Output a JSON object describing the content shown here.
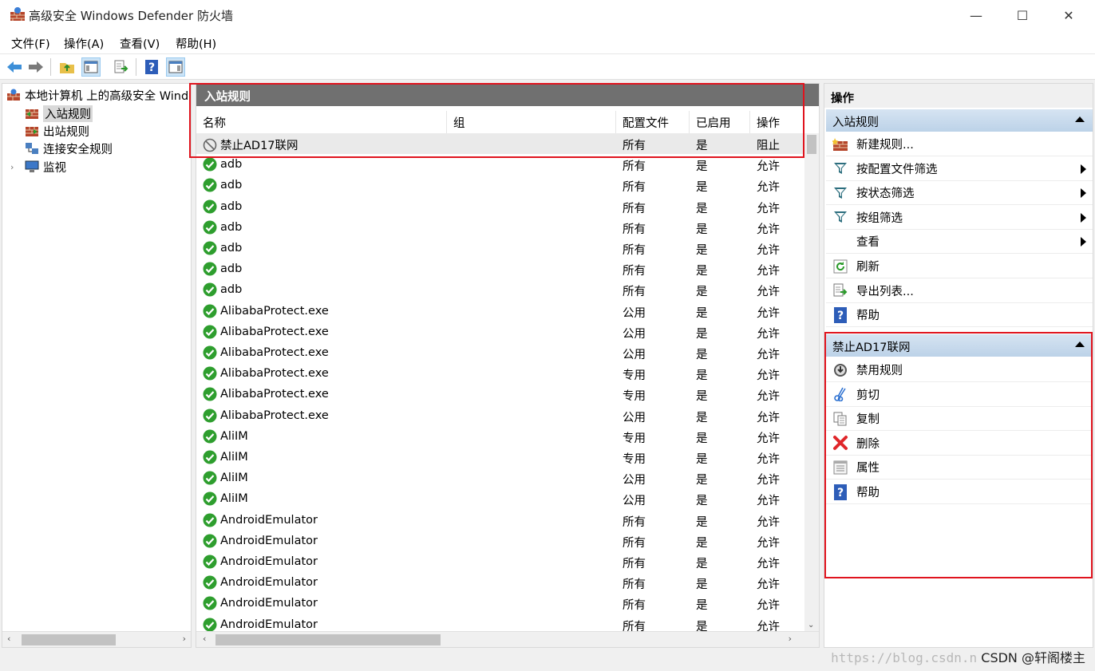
{
  "window": {
    "title": "高级安全 Windows Defender 防火墙",
    "minimize": "—",
    "maximize": "☐",
    "close": "✕"
  },
  "menu": [
    "文件(F)",
    "操作(A)",
    "查看(V)",
    "帮助(H)"
  ],
  "tree": {
    "root": "本地计算机 上的高级安全 Windows Defender 防火墙",
    "items": [
      "入站规则",
      "出站规则",
      "连接安全规则",
      "监视"
    ]
  },
  "list": {
    "header": "入站规则",
    "columns": [
      "名称",
      "组",
      "配置文件",
      "已启用",
      "操作"
    ],
    "rows": [
      {
        "name": "禁止AD17联网",
        "group": "",
        "profile": "所有",
        "enabled": "是",
        "action": "阻止",
        "status": "blocked"
      },
      {
        "name": "adb",
        "group": "",
        "profile": "所有",
        "enabled": "是",
        "action": "允许",
        "status": "allowed"
      },
      {
        "name": "adb",
        "group": "",
        "profile": "所有",
        "enabled": "是",
        "action": "允许",
        "status": "allowed"
      },
      {
        "name": "adb",
        "group": "",
        "profile": "所有",
        "enabled": "是",
        "action": "允许",
        "status": "allowed"
      },
      {
        "name": "adb",
        "group": "",
        "profile": "所有",
        "enabled": "是",
        "action": "允许",
        "status": "allowed"
      },
      {
        "name": "adb",
        "group": "",
        "profile": "所有",
        "enabled": "是",
        "action": "允许",
        "status": "allowed"
      },
      {
        "name": "adb",
        "group": "",
        "profile": "所有",
        "enabled": "是",
        "action": "允许",
        "status": "allowed"
      },
      {
        "name": "adb",
        "group": "",
        "profile": "所有",
        "enabled": "是",
        "action": "允许",
        "status": "allowed"
      },
      {
        "name": "AlibabaProtect.exe",
        "group": "",
        "profile": "公用",
        "enabled": "是",
        "action": "允许",
        "status": "allowed"
      },
      {
        "name": "AlibabaProtect.exe",
        "group": "",
        "profile": "公用",
        "enabled": "是",
        "action": "允许",
        "status": "allowed"
      },
      {
        "name": "AlibabaProtect.exe",
        "group": "",
        "profile": "公用",
        "enabled": "是",
        "action": "允许",
        "status": "allowed"
      },
      {
        "name": "AlibabaProtect.exe",
        "group": "",
        "profile": "专用",
        "enabled": "是",
        "action": "允许",
        "status": "allowed"
      },
      {
        "name": "AlibabaProtect.exe",
        "group": "",
        "profile": "专用",
        "enabled": "是",
        "action": "允许",
        "status": "allowed"
      },
      {
        "name": "AlibabaProtect.exe",
        "group": "",
        "profile": "公用",
        "enabled": "是",
        "action": "允许",
        "status": "allowed"
      },
      {
        "name": "AliIM",
        "group": "",
        "profile": "专用",
        "enabled": "是",
        "action": "允许",
        "status": "allowed"
      },
      {
        "name": "AliIM",
        "group": "",
        "profile": "专用",
        "enabled": "是",
        "action": "允许",
        "status": "allowed"
      },
      {
        "name": "AliIM",
        "group": "",
        "profile": "公用",
        "enabled": "是",
        "action": "允许",
        "status": "allowed"
      },
      {
        "name": "AliIM",
        "group": "",
        "profile": "公用",
        "enabled": "是",
        "action": "允许",
        "status": "allowed"
      },
      {
        "name": "AndroidEmulator",
        "group": "",
        "profile": "所有",
        "enabled": "是",
        "action": "允许",
        "status": "allowed"
      },
      {
        "name": "AndroidEmulator",
        "group": "",
        "profile": "所有",
        "enabled": "是",
        "action": "允许",
        "status": "allowed"
      },
      {
        "name": "AndroidEmulator",
        "group": "",
        "profile": "所有",
        "enabled": "是",
        "action": "允许",
        "status": "allowed"
      },
      {
        "name": "AndroidEmulator",
        "group": "",
        "profile": "所有",
        "enabled": "是",
        "action": "允许",
        "status": "allowed"
      },
      {
        "name": "AndroidEmulator",
        "group": "",
        "profile": "所有",
        "enabled": "是",
        "action": "允许",
        "status": "allowed"
      },
      {
        "name": "AndroidEmulator",
        "group": "",
        "profile": "所有",
        "enabled": "是",
        "action": "允许",
        "status": "allowed"
      }
    ]
  },
  "actions": {
    "title": "操作",
    "section1": {
      "label": "入站规则",
      "items": [
        {
          "label": "新建规则...",
          "icon": "new-rule-icon",
          "submenu": false
        },
        {
          "label": "按配置文件筛选",
          "icon": "filter-icon",
          "submenu": true
        },
        {
          "label": "按状态筛选",
          "icon": "filter-icon",
          "submenu": true
        },
        {
          "label": "按组筛选",
          "icon": "filter-icon",
          "submenu": true
        },
        {
          "label": "查看",
          "icon": "",
          "submenu": true
        },
        {
          "label": "刷新",
          "icon": "refresh-icon",
          "submenu": false
        },
        {
          "label": "导出列表...",
          "icon": "export-icon",
          "submenu": false
        },
        {
          "label": "帮助",
          "icon": "help-icon",
          "submenu": false
        }
      ]
    },
    "section2": {
      "label": "禁止AD17联网",
      "items": [
        {
          "label": "禁用规则",
          "icon": "disable-icon",
          "submenu": false
        },
        {
          "label": "剪切",
          "icon": "cut-icon",
          "submenu": false
        },
        {
          "label": "复制",
          "icon": "copy-icon",
          "submenu": false
        },
        {
          "label": "删除",
          "icon": "delete-icon",
          "submenu": false
        },
        {
          "label": "属性",
          "icon": "properties-icon",
          "submenu": false
        },
        {
          "label": "帮助",
          "icon": "help-icon",
          "submenu": false
        }
      ]
    }
  },
  "watermark": {
    "url": "https://blog.csdn.n",
    "author": "CSDN @轩阁楼主"
  },
  "colors": {
    "highlight_box": "#e0141e",
    "section_header": "#c8dbee",
    "list_header": "#707070",
    "allowed": "#2e9e2e"
  }
}
